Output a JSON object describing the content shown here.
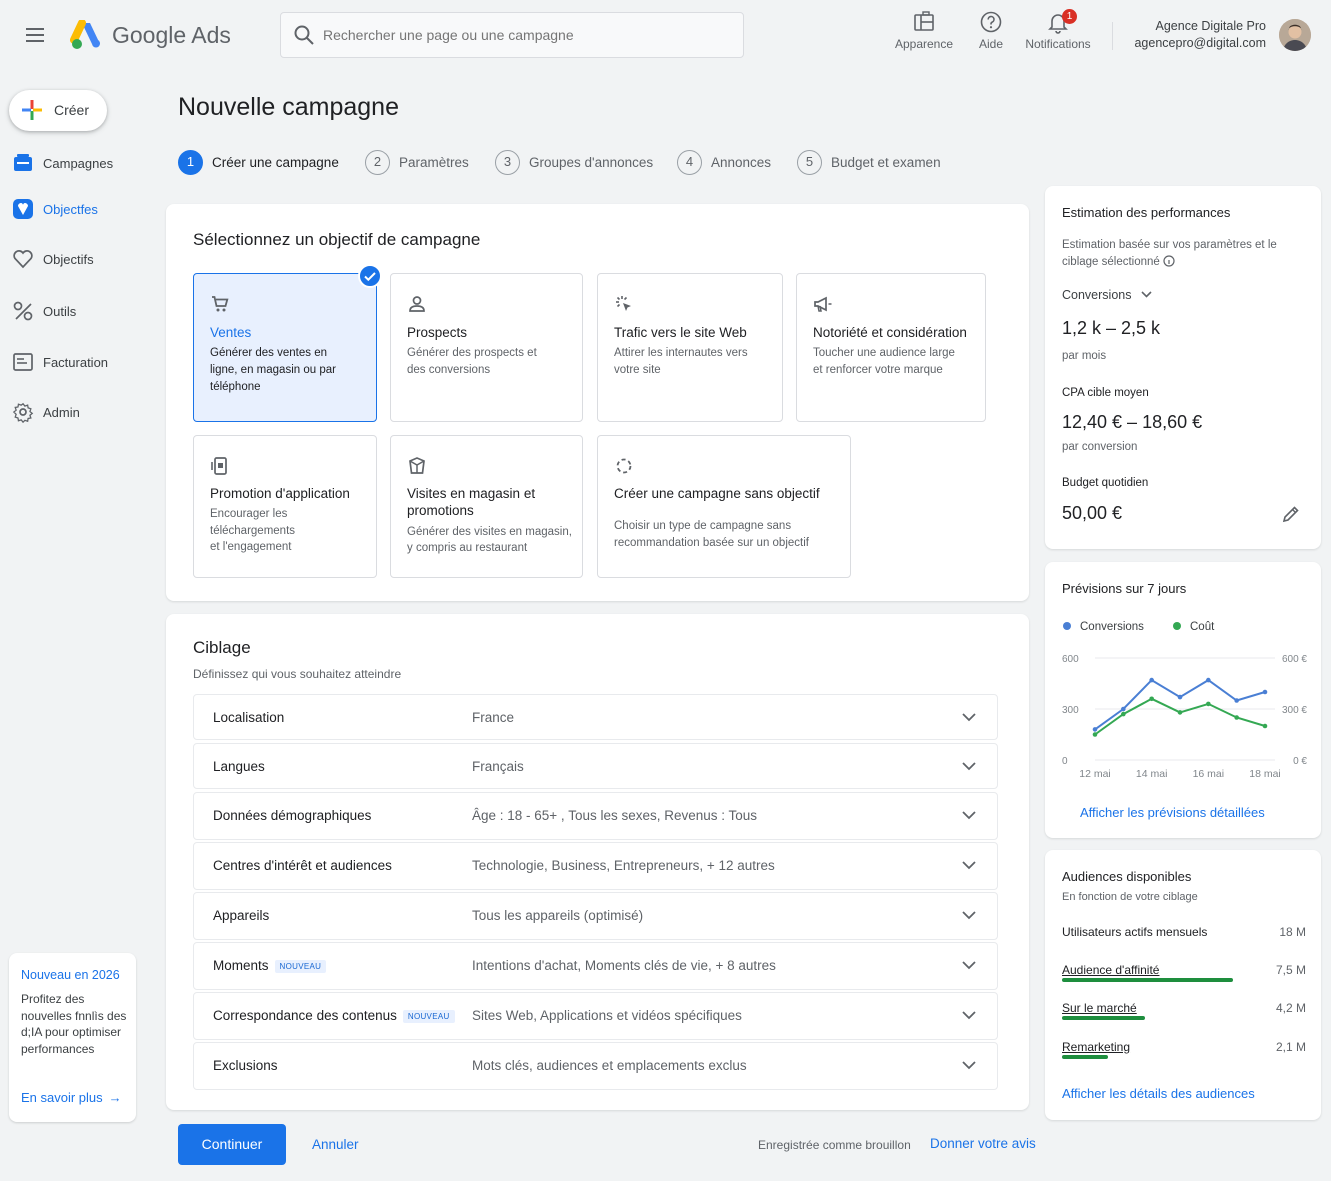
{
  "header": {
    "brand": "Google Ads",
    "search_placeholder": "Rechercher une page ou une campagne",
    "actions": [
      {
        "label": "Apparence",
        "icon": "appearance-icon"
      },
      {
        "label": "Aide",
        "icon": "help-icon"
      },
      {
        "label": "Notifications",
        "icon": "bell-icon",
        "badge": "1"
      }
    ],
    "account": {
      "name": "Agence Digitale Pro",
      "email": "agencepro@digital.com"
    }
  },
  "sidebar": {
    "create_label": "Créer",
    "items": [
      {
        "label": "Campagnes",
        "icon": "campaigns-icon"
      },
      {
        "label": "Objectfes",
        "icon": "goals-icon",
        "active": true
      },
      {
        "label": "Objectifs",
        "icon": "heart-icon"
      },
      {
        "label": "Outils",
        "icon": "tools-icon"
      },
      {
        "label": "Facturation",
        "icon": "billing-icon"
      },
      {
        "label": "Admin",
        "icon": "gear-icon"
      }
    ],
    "promo": {
      "title": "Nouveau en 2026",
      "text_lines": [
        "Profitez des",
        "nouvelles fnnlìs des",
        "d;IA pour optimiser",
        "performances"
      ],
      "link": "En savoir plus"
    }
  },
  "page": {
    "title": "Nouvelle campagne",
    "steps": [
      {
        "num": "1",
        "label": "Créer une campagne",
        "active": true
      },
      {
        "num": "2",
        "label": "Paramètres"
      },
      {
        "num": "3",
        "label": "Groupes d'annonces"
      },
      {
        "num": "4",
        "label": "Annonces"
      },
      {
        "num": "5",
        "label": "Budget et examen"
      }
    ]
  },
  "objectives": {
    "title": "Sélectionnez un objectif de campagne",
    "tiles": [
      {
        "title": "Ventes",
        "desc": [
          "Générer des ventes en",
          "ligne, en magasin ou par",
          "téléphone"
        ],
        "icon": "cart-icon",
        "selected": true
      },
      {
        "title": "Prospects",
        "desc": [
          "Générer des prospects et",
          "des conversions"
        ],
        "icon": "person-icon"
      },
      {
        "title": "Trafic vers le site Web",
        "desc": [
          "Attirer les internautes vers",
          "votre site"
        ],
        "icon": "click-icon"
      },
      {
        "title": "Notoriété et considération",
        "desc": [
          "Toucher une audience large",
          "et renforcer votre marque"
        ],
        "icon": "megaphone-icon"
      },
      {
        "title": "Promotion d'application",
        "desc": [
          "Encourager les",
          "téléchargements",
          "et l'engagement"
        ],
        "icon": "phone-app-icon"
      },
      {
        "title": "Visites en magasin et promotions",
        "desc": [
          "Générer des visites en magasin,",
          "y compris au restaurant"
        ],
        "icon": "store-icon"
      },
      {
        "title": "Créer une campagne sans objectif",
        "desc": [
          "Choisir un type de campagne sans",
          "recommandation basée sur un objectif"
        ],
        "icon": "dashed-circle-icon"
      }
    ]
  },
  "targeting": {
    "title": "Ciblage",
    "subtitle": "Définissez qui vous souhaitez atteindre",
    "rows": [
      {
        "label": "Localisation",
        "value": "France"
      },
      {
        "label": "Langues",
        "value": "Français"
      },
      {
        "label": "Données démographiques",
        "value": "Âge : 18 - 65+ , Tous les sexes, Revenus : Tous"
      },
      {
        "label": "Centres d'intérêt et audiences",
        "value": "Technologie, Business, Entrepreneurs, + 12 autres"
      },
      {
        "label": "Appareils",
        "value": "Tous les appareils (optimisé)"
      },
      {
        "label": "Moments",
        "value": "Intentions d'achat, Moments clés de vie, + 8 autres",
        "tag": "NOUVEAU"
      },
      {
        "label": "Correspondance des contenus",
        "value": "Sites Web, Applications et vidéos spécifiques",
        "tag": "NOUVEAU"
      },
      {
        "label": "Exclusions",
        "value": "Mots clés, audiences et emplacements exclus"
      }
    ]
  },
  "footer": {
    "continue": "Continuer",
    "cancel": "Annuler",
    "draft": "Enregistrée comme brouillon",
    "feedback": "Donner votre avis"
  },
  "performance": {
    "title": "Estimation des performances",
    "desc_lines": [
      "Estimation basée sur vos paramètres et le",
      "ciblage sélectionné"
    ],
    "metric_select": "Conversions",
    "conversions_range": "1,2 k – 2,5 k",
    "per_month": "par mois",
    "cpa_label": "CPA cible moyen",
    "cpa_range": "12,40 € – 18,60 €",
    "per_conversion": "par conversion",
    "budget_label": "Budget quotidien",
    "budget_value": "50,00 €"
  },
  "forecast": {
    "title": "Prévisions sur 7 jours",
    "link": "Afficher les prévisions détaillées",
    "chart_data": {
      "type": "line",
      "x": [
        "12 mai",
        "13 mai",
        "14 mai",
        "15 mai",
        "16 mai",
        "17 mai",
        "18 mai"
      ],
      "x_ticks": [
        "12 mai",
        "14 mai",
        "16 mai",
        "18 mai"
      ],
      "y_left_ticks": [
        "600",
        "300",
        "0"
      ],
      "y_right_ticks": [
        "600 €",
        "300 €",
        "0 €"
      ],
      "ylim": [
        0,
        600
      ],
      "series": [
        {
          "name": "Conversions",
          "color": "#4a7fd4",
          "values": [
            180,
            300,
            470,
            370,
            470,
            350,
            400
          ]
        },
        {
          "name": "Coût",
          "color": "#34a853",
          "values": [
            150,
            270,
            360,
            280,
            330,
            250,
            200
          ]
        }
      ],
      "grid": true,
      "legend": "top-left"
    }
  },
  "audiences": {
    "title": "Audiences disponibles",
    "subtitle": "En fonction de votre ciblage",
    "rows": [
      {
        "label": "Utilisateurs actifs mensuels",
        "count": "18 M",
        "share": 0
      },
      {
        "label": "Audience d'affinité",
        "count": "7,5 M",
        "share": 0.7
      },
      {
        "label": "Sur le marché",
        "count": "4,2 M",
        "share": 0.34
      },
      {
        "label": "Remarketing",
        "count": "2,1 M",
        "share": 0.19
      }
    ],
    "link": "Afficher les détails des audiences"
  }
}
